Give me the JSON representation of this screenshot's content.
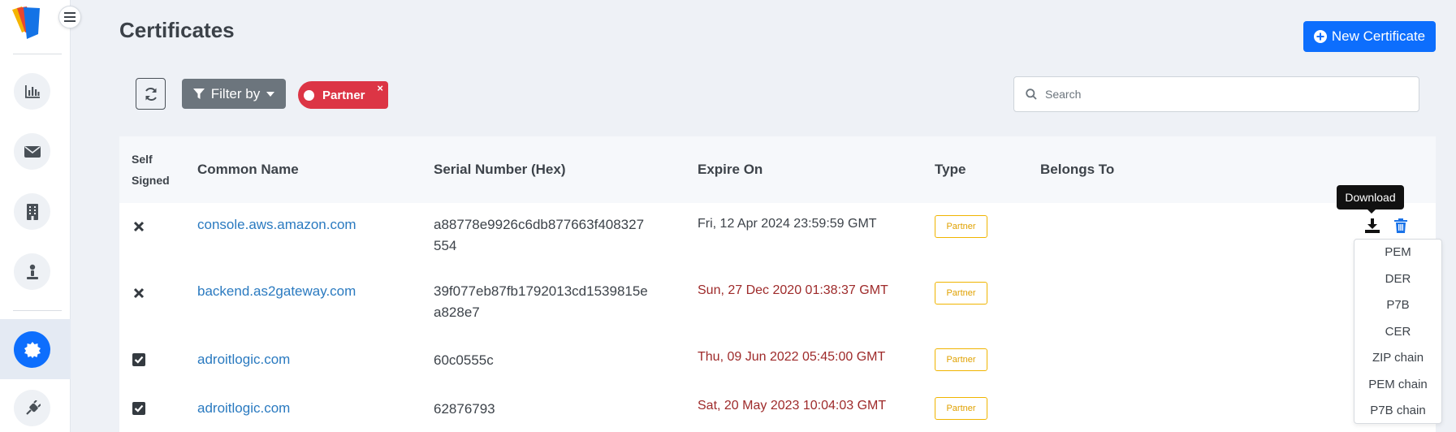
{
  "page": {
    "title": "Certificates",
    "new_button_label": "New Certificate"
  },
  "toolbar": {
    "filter_label": "Filter by",
    "chip_label": "Partner",
    "chip_remove": "×",
    "search_placeholder": "Search"
  },
  "sidebar": {
    "items": [
      {
        "icon": "chart-icon"
      },
      {
        "icon": "envelope-icon"
      },
      {
        "icon": "building-icon"
      },
      {
        "icon": "person-icon"
      },
      {
        "icon": "certificate-icon",
        "active": true
      },
      {
        "icon": "plug-icon"
      }
    ],
    "colors": {
      "active": "#0d6efd"
    }
  },
  "table": {
    "headers": {
      "self_signed_line1": "Self",
      "self_signed_line2": "Signed",
      "common_name": "Common Name",
      "serial": "Serial Number (Hex)",
      "expire": "Expire On",
      "type": "Type",
      "belongs_to": "Belongs To"
    },
    "rows": [
      {
        "self_signed": false,
        "common_name": "console.aws.amazon.com",
        "serial_line1": "a88778e9926c6db877663f408327",
        "serial_line2": "554",
        "expire": "Fri, 12 Apr 2024 23:59:59 GMT",
        "expired": false,
        "type": "Partner"
      },
      {
        "self_signed": false,
        "common_name": "backend.as2gateway.com",
        "serial_line1": "39f077eb87fb1792013cd1539815e",
        "serial_line2": "a828e7",
        "expire": "Sun, 27 Dec 2020 01:38:37 GMT",
        "expired": true,
        "type": "Partner"
      },
      {
        "self_signed": true,
        "common_name": "adroitlogic.com",
        "serial_line1": "60c0555c",
        "serial_line2": "",
        "expire": "Thu, 09 Jun 2022 05:45:00 GMT",
        "expired": true,
        "type": "Partner"
      },
      {
        "self_signed": true,
        "common_name": "adroitlogic.com",
        "serial_line1": "62876793",
        "serial_line2": "",
        "expire": "Sat, 20 May 2023 10:04:03 GMT",
        "expired": true,
        "type": "Partner"
      }
    ]
  },
  "actions": {
    "tooltip": "Download",
    "download_menu": [
      "PEM",
      "DER",
      "P7B",
      "CER",
      "ZIP chain",
      "PEM chain",
      "P7B chain"
    ]
  },
  "colors": {
    "primary": "#0d6efd",
    "danger": "#dc3545",
    "link": "#2a7ac0",
    "expired_text": "#9e2a2a",
    "badge": "#f0b400"
  }
}
